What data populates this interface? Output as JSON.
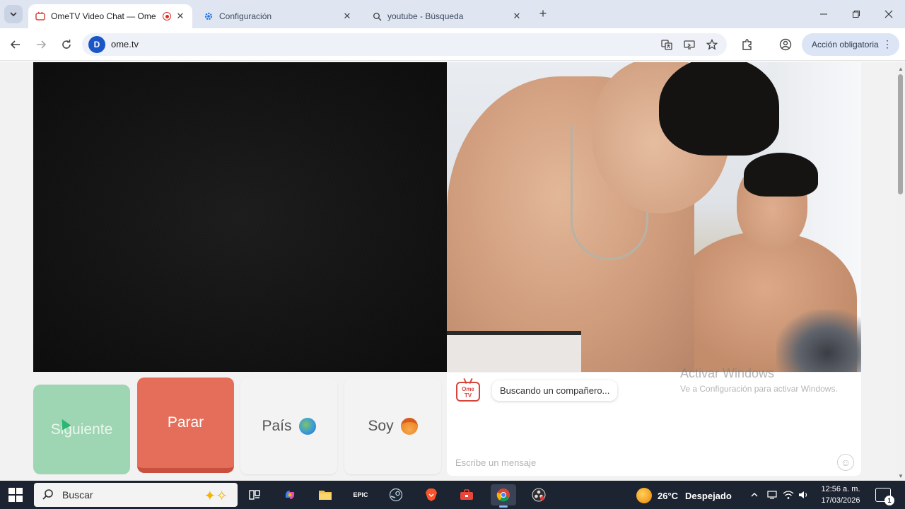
{
  "browser": {
    "tabs": [
      {
        "title": "OmeTV Video Chat — Ome",
        "icon": "ometv-favicon",
        "active": true,
        "recording": true
      },
      {
        "title": "Configuración",
        "icon": "gear-icon",
        "active": false
      },
      {
        "title": "youtube - Búsqueda",
        "icon": "search-icon",
        "active": false
      }
    ],
    "url": "ome.tv",
    "site_icon_letter": "D",
    "profile_button": "Acción obligatoria",
    "colors": {
      "tabstrip": "#dfe6f1",
      "omnibox": "#eef2f8",
      "profile_pill": "#dbe5f6"
    }
  },
  "controls": {
    "next_label": "Siguiente",
    "stop_label": "Parar",
    "country_label": "País",
    "country_icon": "globe-icon",
    "me_label": "Soy",
    "me_icon": "face-icon",
    "colors": {
      "next": "#9ed5b2",
      "stop": "#e56e5a",
      "neutral": "#f3f3f3"
    }
  },
  "chat": {
    "logo_line1": "Ome",
    "logo_line2": "TV",
    "status_message": "Buscando un compañero...",
    "input_placeholder": "Escribe un mensaje",
    "emoji_icon": "smiley-icon"
  },
  "watermark": {
    "line1": "Activar Windows",
    "line2": "Ve a Configuración para activar Windows."
  },
  "taskbar": {
    "search_placeholder": "Buscar",
    "apps": [
      "task-view-icon",
      "copilot-icon",
      "file-explorer-icon",
      "epic-games-icon",
      "steam-icon",
      "brave-icon",
      "toolbox-icon",
      "chrome-icon",
      "obs-icon"
    ],
    "epic_label": "EPIC",
    "weather_temp": "26°C",
    "weather_condition": "Despejado",
    "time": "12:56 a. m.",
    "date": "17/03/2026",
    "notification_count": "1"
  }
}
